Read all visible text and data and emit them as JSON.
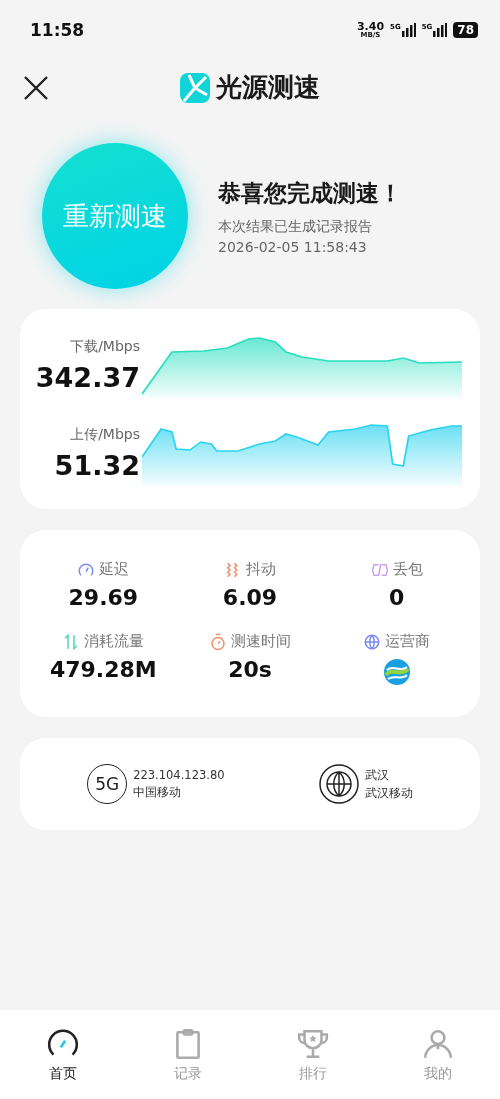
{
  "status_bar": {
    "time": "11:58",
    "net_speed": "3.40",
    "net_unit": "MB/S",
    "sim1": "5G",
    "sim2": "5G",
    "battery": "78"
  },
  "header": {
    "title": "光源测速"
  },
  "hero": {
    "button": "重新测速",
    "headline": "恭喜您完成测速！",
    "subtitle": "本次结果已生成记录报告",
    "timestamp": "2026-02-05 11:58:43"
  },
  "speeds": [
    {
      "kind": "download",
      "label": "下载/Mbps",
      "value": "342.37"
    },
    {
      "kind": "upload",
      "label": "上传/Mbps",
      "value": "51.32"
    }
  ],
  "stats": [
    {
      "kind": "latency",
      "label": "延迟",
      "value": "29.69"
    },
    {
      "kind": "jitter",
      "label": "抖动",
      "value": "6.09"
    },
    {
      "kind": "loss",
      "label": "丢包",
      "value": "0"
    },
    {
      "kind": "traffic",
      "label": "消耗流量",
      "value": "479.28M"
    },
    {
      "kind": "duration",
      "label": "测速时间",
      "value": "20s"
    },
    {
      "kind": "carrier",
      "label": "运营商"
    }
  ],
  "network": [
    {
      "kind": "cellular",
      "badge": "5G",
      "line1": "223.104.123.80",
      "line2": "中国移动"
    },
    {
      "kind": "location",
      "line1": "武汉",
      "line2": "武汉移动"
    }
  ],
  "tabs": [
    {
      "kind": "home",
      "label": "首页",
      "selected": true
    },
    {
      "kind": "records",
      "label": "记录",
      "selected": false
    },
    {
      "kind": "ranking",
      "label": "排行",
      "selected": false
    },
    {
      "kind": "profile",
      "label": "我的",
      "selected": false
    }
  ]
}
